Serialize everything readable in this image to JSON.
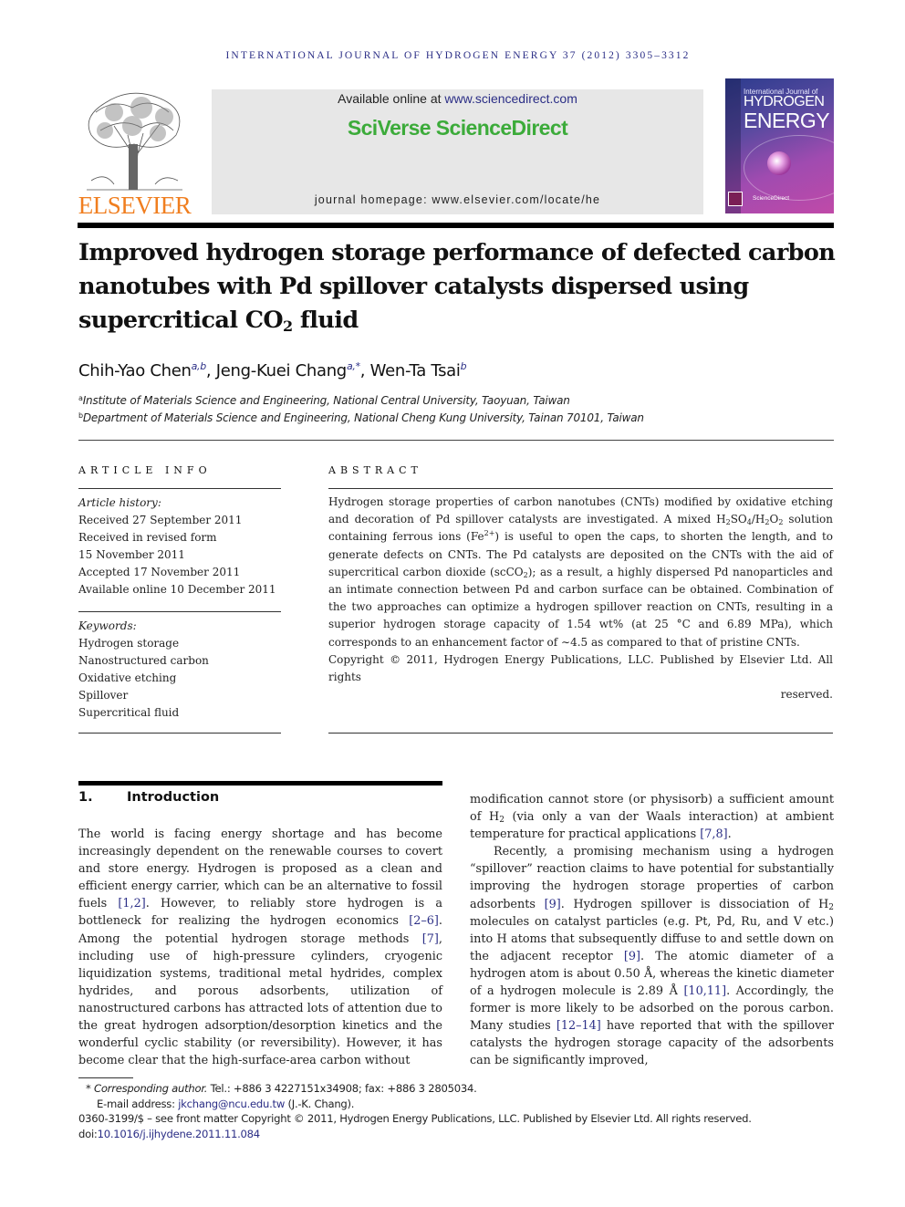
{
  "running_head": "INTERNATIONAL JOURNAL OF HYDROGEN ENERGY 37 (2012) 3305–3312",
  "header": {
    "publisher_logo": "ELSEVIER",
    "available_prefix": "Available online at ",
    "available_link": "www.sciencedirect.com",
    "platform_brand": "SciVerse ScienceDirect",
    "homepage_label": "journal homepage: www.elsevier.com/locate/he",
    "cover": {
      "line1": "International Journal of",
      "line2": "HYDROGEN",
      "line3": "ENERGY",
      "footer": "ScienceDirect"
    }
  },
  "article": {
    "title_part1": "Improved hydrogen storage performance of defected carbon nanotubes with Pd spillover catalysts dispersed using supercritical CO",
    "title_sub": "2",
    "title_part2": " fluid",
    "authors": [
      {
        "name": "Chih-Yao Chen",
        "sup": "a,b"
      },
      {
        "name": "Jeng-Kuei Chang",
        "sup": "a,*"
      },
      {
        "name": "Wen-Ta Tsai",
        "sup": "b"
      }
    ],
    "affiliations": [
      {
        "mark": "a",
        "text": "Institute of Materials Science and Engineering, National Central University, Taoyuan, Taiwan"
      },
      {
        "mark": "b",
        "text": "Department of Materials Science and Engineering, National Cheng Kung University, Tainan 70101, Taiwan"
      }
    ]
  },
  "article_info": {
    "heading": "ARTICLE INFO",
    "history_label": "Article history:",
    "history": [
      "Received 27 September 2011",
      "Received in revised form",
      "15 November 2011",
      "Accepted 17 November 2011",
      "Available online 10 December 2011"
    ],
    "keywords_label": "Keywords:",
    "keywords": [
      "Hydrogen storage",
      "Nanostructured carbon",
      "Oxidative etching",
      "Spillover",
      "Supercritical fluid"
    ]
  },
  "abstract": {
    "heading": "ABSTRACT",
    "p1": "Hydrogen storage properties of carbon nanotubes (CNTs) modified by oxidative etching and decoration of Pd spillover catalysts are investigated. A mixed H",
    "p2": "SO",
    "p3": "/H",
    "p4": "O",
    "p5": " solution containing ferrous ions (Fe",
    "p6": ") is useful to open the caps, to shorten the length, and to generate defects on CNTs. The Pd catalysts are deposited on the CNTs with the aid of supercritical carbon dioxide (scCO",
    "p7": "); as a result, a highly dispersed Pd nanoparticles and an intimate connection between Pd and carbon surface can be obtained. Combination of the two approaches can optimize a hydrogen spillover reaction on CNTs, resulting in a superior hydrogen storage capacity of 1.54 wt% (at 25 °C and 6.89 MPa), which corresponds to an enhancement factor of ∼4.5 as compared to that of pristine CNTs.",
    "sub2": "2",
    "sub4": "4",
    "fe_charge": "2+",
    "copyright": "Copyright © 2011, Hydrogen Energy Publications, LLC. Published by Elsevier Ltd. All rights",
    "copyright_end": "reserved."
  },
  "introduction": {
    "number": "1.",
    "heading": "Introduction",
    "left": {
      "t1": "The world is facing energy shortage and has become increasingly dependent on the renewable courses to covert and store energy. Hydrogen is proposed as a clean and efficient energy carrier, which can be an alternative to fossil fuels ",
      "c1": "[1,2]",
      "t2": ". However, to reliably store hydrogen is a bottleneck for realizing the hydrogen economics ",
      "c2": "[2–6]",
      "t3": ". Among the potential hydrogen storage methods ",
      "c3": "[7]",
      "t4": ", including use of high-pressure cylinders, cryogenic liquidization systems, traditional metal hydrides, complex hydrides, and porous adsorbents, utilization of nanostructured carbons has attracted lots of attention due to the great hydrogen adsorption/desorption kinetics and the wonderful cyclic stability (or reversibility). However, it has become clear that the high-surface-area carbon without"
    },
    "right": {
      "t1": "modification cannot store (or physisorb) a sufficient amount of H",
      "t1_sub": "2",
      "t2": " (via only a van der Waals interaction) at ambient temperature for practical applications ",
      "c1": "[7,8]",
      "t3": ".",
      "p2_t1": "Recently, a promising mechanism using a hydrogen “spillover” reaction claims to have potential for substantially improving the hydrogen storage properties of carbon adsorbents ",
      "c2": "[9]",
      "p2_t2": ". Hydrogen spillover is dissociation of H",
      "p2_sub": "2",
      "p2_t3": " molecules on catalyst particles (e.g. Pt, Pd, Ru, and V etc.) into H atoms that subsequently diffuse to and settle down on the adjacent receptor ",
      "c3": "[9]",
      "p2_t4": ". The atomic diameter of a hydrogen atom is about 0.50 Å, whereas the kinetic diameter of a hydrogen molecule is 2.89 Å ",
      "c4": "[10,11]",
      "p2_t5": ". Accordingly, the former is more likely to be adsorbed on the porous carbon. Many studies ",
      "c5": "[12–14]",
      "p2_t6": " have reported that with the spillover catalysts the hydrogen storage capacity of the adsorbents can be significantly improved,"
    }
  },
  "footnotes": {
    "star": "*",
    "corr_label": "Corresponding author.",
    "corr_text": " Tel.: +886 3 4227151x34908; fax: +886 3 2805034.",
    "email_label": "E-mail address: ",
    "email": "jkchang@ncu.edu.tw",
    "email_suffix": " (J.-K. Chang).",
    "issn_line": "0360-3199/$ – see front matter Copyright © 2011, Hydrogen Energy Publications, LLC. Published by Elsevier Ltd. All rights reserved.",
    "doi_label": "doi:",
    "doi": "10.1016/j.ijhydene.2011.11.084"
  },
  "colors": {
    "link": "#2b2e86",
    "elsevier_orange": "#f07e1f",
    "sciencedirect_green": "#3cab3a",
    "header_box": "#e7e7e7"
  }
}
